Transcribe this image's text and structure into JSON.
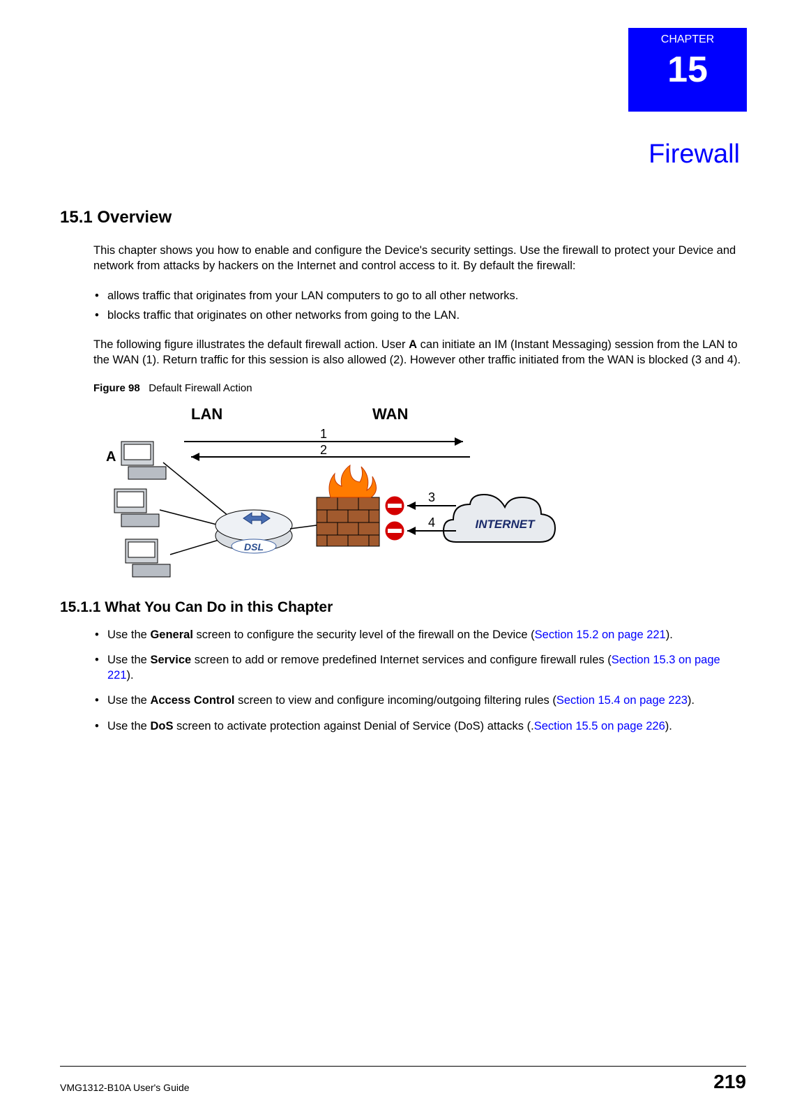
{
  "chapter": {
    "label": "CHAPTER",
    "number": "15",
    "title": "Firewall"
  },
  "section1": {
    "heading": "15.1  Overview",
    "intro": "This chapter shows you how to enable and configure the Device's security settings. Use the firewall to protect your Device and network from attacks by hackers on the Internet and control access to it. By default the firewall:",
    "bullets": [
      "allows traffic that originates from your LAN computers to go to all other networks.",
      "blocks traffic that originates on other networks from going to the LAN."
    ],
    "followup_pre": "The following figure illustrates the default firewall action. User ",
    "followup_bold": "A",
    "followup_post": " can initiate an IM (Instant Messaging) session from the LAN to the WAN (1). Return traffic for this session is also allowed (2). However other traffic initiated from the WAN is blocked (3 and 4).",
    "figure": {
      "label": "Figure 98",
      "caption": "Default Firewall Action",
      "labels": {
        "lan": "LAN",
        "wan": "WAN",
        "a": "A",
        "n1": "1",
        "n2": "2",
        "n3": "3",
        "n4": "4",
        "dsl": "DSL",
        "internet": "INTERNET"
      }
    }
  },
  "section1_1": {
    "heading": "15.1.1  What You Can Do in this Chapter",
    "items": [
      {
        "pre": "Use the ",
        "bold": "General",
        "mid": " screen to configure the security level of the firewall on the Device (",
        "link": "Section 15.2 on page 221",
        "post": ")."
      },
      {
        "pre": "Use the ",
        "bold": "Service",
        "mid": " screen to add or remove predefined Internet services and configure firewall rules (",
        "link": "Section 15.3 on page 221",
        "post": ")."
      },
      {
        "pre": "Use the ",
        "bold": "Access Control",
        "mid": " screen to view and configure incoming/outgoing filtering rules (",
        "link": "Section 15.4 on page 223",
        "post": ")."
      },
      {
        "pre": "Use the ",
        "bold": "DoS",
        "mid": " screen to activate protection against Denial of Service (DoS) attacks (.",
        "link": "Section 15.5 on page 226",
        "post": ")."
      }
    ]
  },
  "footer": {
    "guide": "VMG1312-B10A User's Guide",
    "page": "219"
  }
}
